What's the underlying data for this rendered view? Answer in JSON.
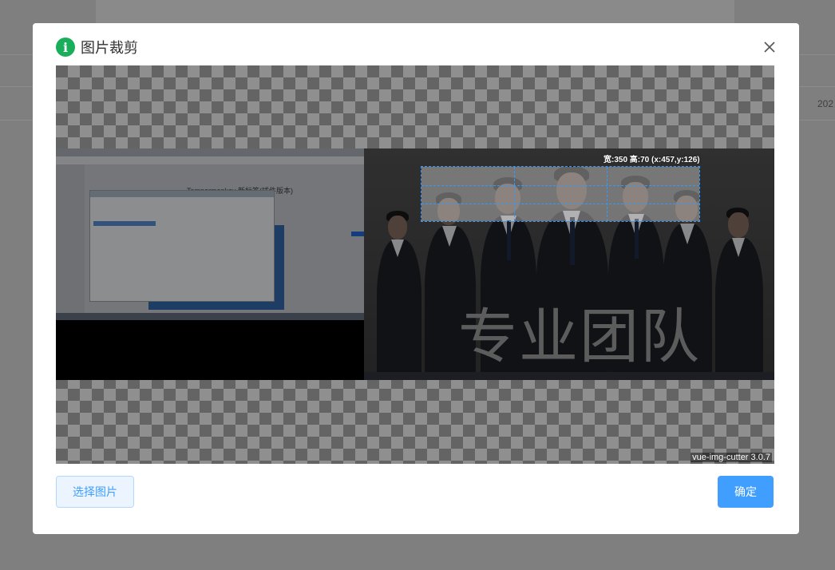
{
  "background_page": {
    "cell_text": "202"
  },
  "dialog": {
    "title": "图片裁剪",
    "info_icon_glyph": "i",
    "icon": "info-circle-icon",
    "close_icon": "close-icon",
    "accent_color": "#1aad5a"
  },
  "cutter": {
    "crop_info": "宽:350 高:70 (x:457,y:126)",
    "version_label": "vue-img-cutter 3.0.7",
    "image": {
      "left_window_title": "Tampermonkey 新标签(插件版本)",
      "slogan": "专业团队"
    }
  },
  "footer": {
    "choose_image_label": "选择图片",
    "confirm_label": "确定",
    "primary_color": "#409eff"
  }
}
